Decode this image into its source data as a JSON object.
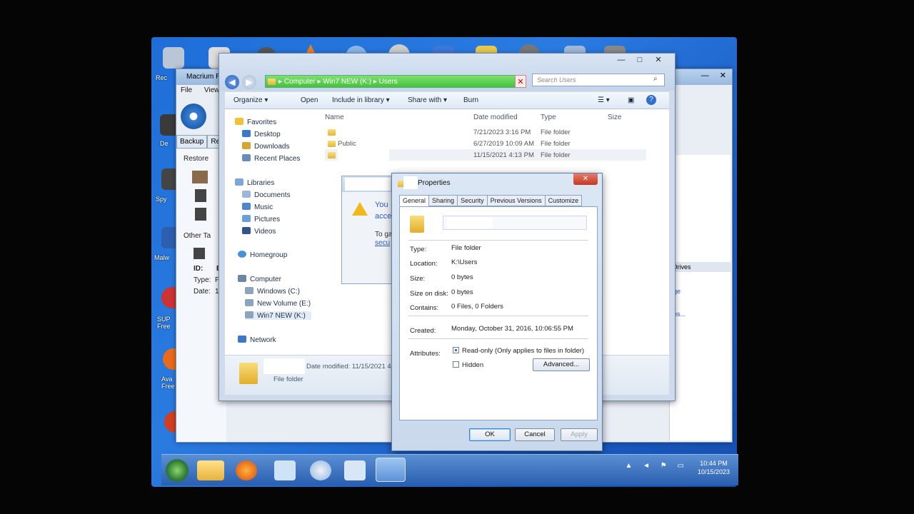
{
  "desktop": {
    "icon_labels": [
      "Rec",
      "De",
      "Spy",
      "Malw",
      "SUP Free",
      "Ava Free"
    ]
  },
  "macrium": {
    "title": "Macrium R",
    "menu": [
      "File",
      "View"
    ],
    "tabs": [
      "Backup",
      "Re"
    ],
    "left": {
      "restore": "Restore",
      "other": "Other Ta",
      "id_label": "ID:",
      "id_value": "B",
      "type_label": "Type:",
      "type_value": "Fu",
      "date_label": "Date:",
      "date_value": "10"
    },
    "right": {
      "drives": "Drives",
      "image": "age",
      "options": "ons..."
    }
  },
  "explorer": {
    "window_buttons": [
      "—",
      "□",
      "✕"
    ],
    "back_icon": "back-arrow-icon",
    "address": [
      "Computer",
      "Win7 NEW (K:)",
      "Users"
    ],
    "search_placeholder": "Search Users",
    "toolbar": [
      "Organize ▾",
      "Open",
      "Include in library ▾",
      "Share with ▾",
      "Burn"
    ],
    "nav": {
      "favorites": "Favorites",
      "desktop": "Desktop",
      "downloads": "Downloads",
      "recent": "Recent Places",
      "libraries": "Libraries",
      "documents": "Documents",
      "music": "Music",
      "pictures": "Pictures",
      "videos": "Videos",
      "homegroup": "Homegroup",
      "computer": "Computer",
      "windows": "Windows (C:)",
      "newvolume": "New Volume (E:)",
      "win7": "Win7 NEW (K:)",
      "network": "Network"
    },
    "columns": [
      "Name",
      "Date modified",
      "Type",
      "Size"
    ],
    "rows": [
      {
        "name": "",
        "date": "7/21/2023 3:16 PM",
        "type": "File folder"
      },
      {
        "name": "Public",
        "date": "6/27/2019 10:09 AM",
        "type": "File folder"
      },
      {
        "name": "",
        "date": "11/15/2021 4:13 PM",
        "type": "File folder"
      }
    ],
    "details": {
      "date_label": "Date modified: 11/15/2021 4:1",
      "type": "File folder"
    }
  },
  "error_dialog": {
    "line1": "You",
    "line2": "acce",
    "line3": "To ga",
    "link": "secu"
  },
  "properties": {
    "title": "Properties",
    "close": "✕",
    "tabs": [
      "General",
      "Sharing",
      "Security",
      "Previous Versions",
      "Customize"
    ],
    "type_label": "Type:",
    "type_value": "File folder",
    "location_label": "Location:",
    "location_value": "K:\\Users",
    "size_label": "Size:",
    "size_value": "0 bytes",
    "sizeondisk_label": "Size on disk:",
    "sizeondisk_value": "0 bytes",
    "contains_label": "Contains:",
    "contains_value": "0 Files, 0 Folders",
    "created_label": "Created:",
    "created_value": "Monday, October 31, 2016, 10:06:55 PM",
    "attributes_label": "Attributes:",
    "readonly_label": "Read-only (Only applies to files in folder)",
    "hidden_label": "Hidden",
    "advanced": "Advanced...",
    "ok": "OK",
    "cancel": "Cancel",
    "apply": "Apply"
  },
  "taskbar": {
    "time": "10:44 PM",
    "date": "10/15/2023",
    "tray": "▲ ◄ ⚑ ▭"
  },
  "colors": {
    "desktop": "#1f6ed8",
    "address_bar": "#45c23a",
    "close_red": "#c23a22"
  }
}
